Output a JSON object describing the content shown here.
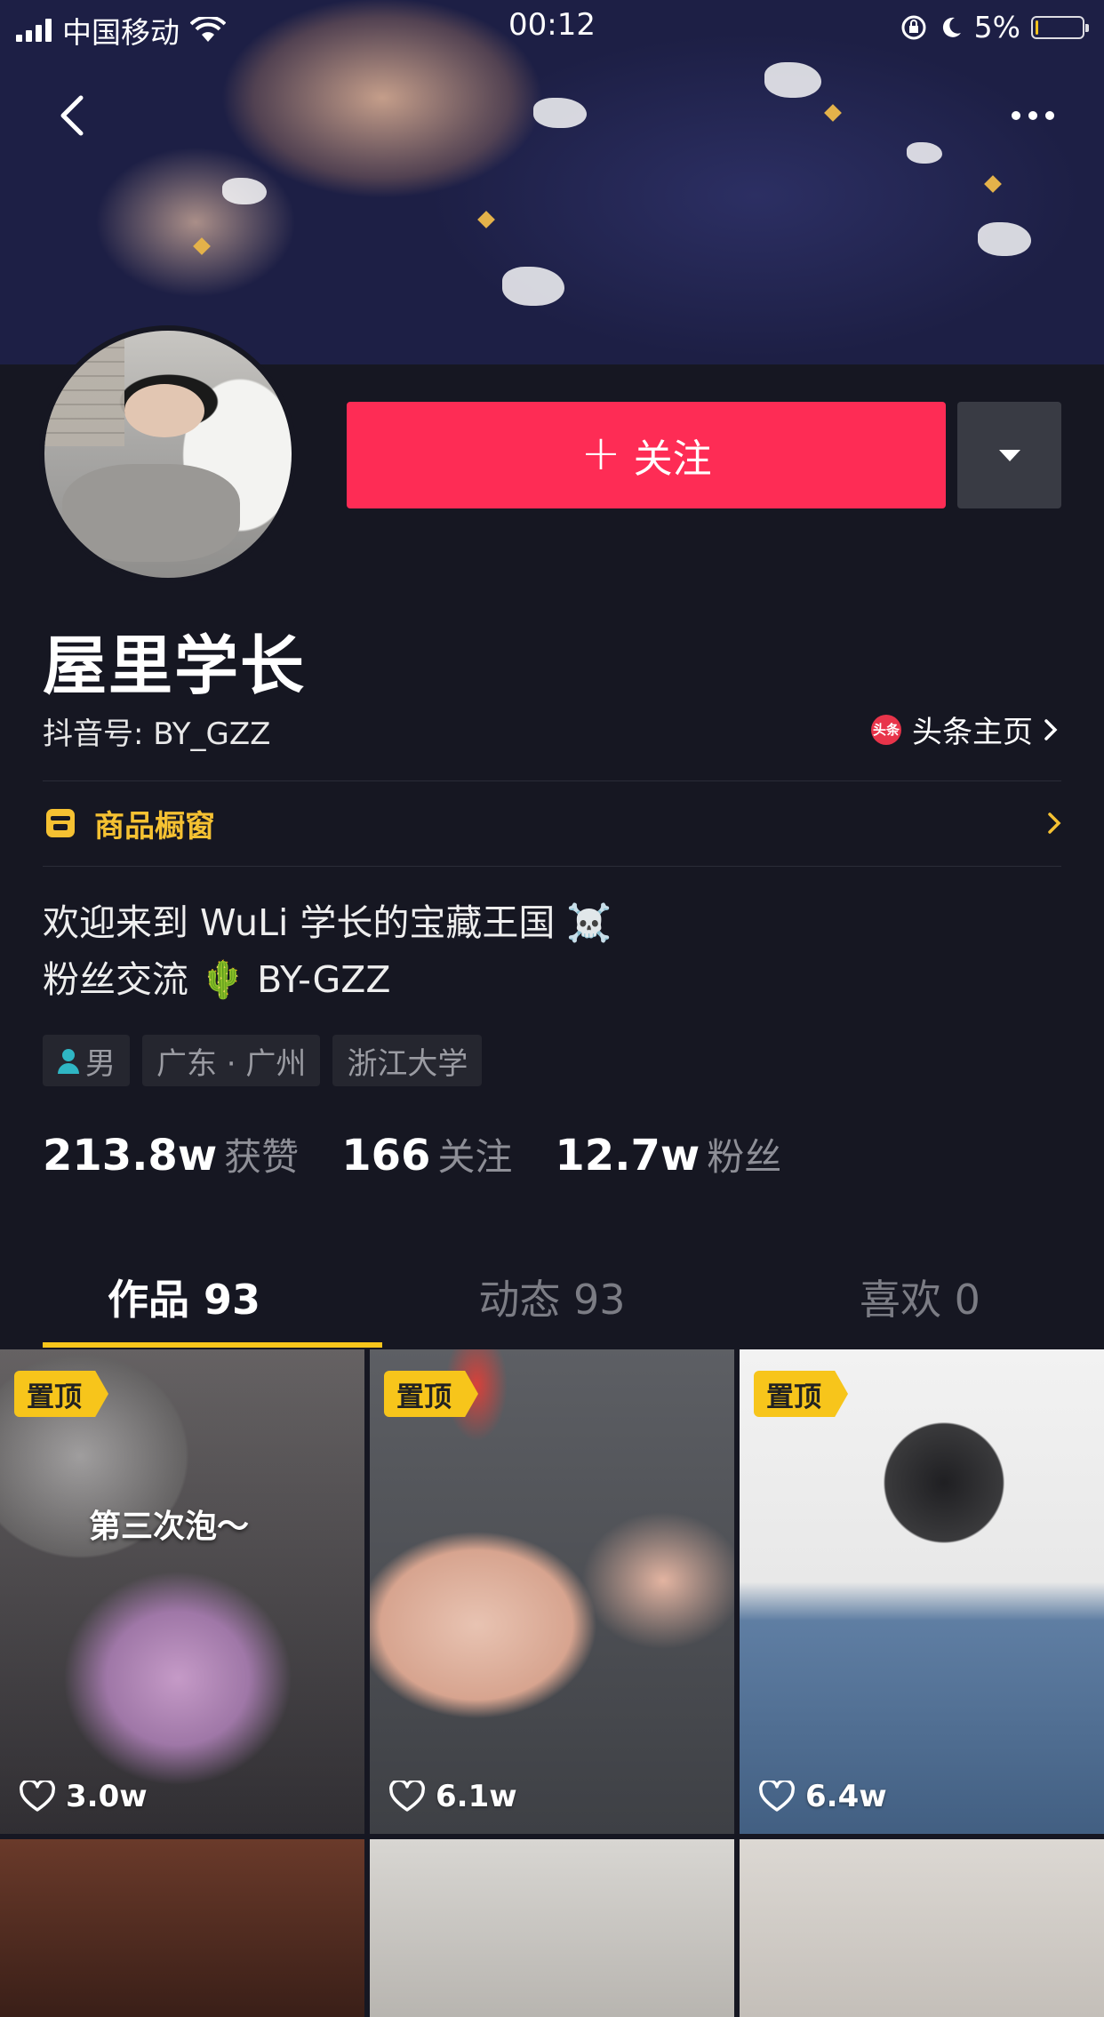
{
  "status_bar": {
    "carrier": "中国移动",
    "time": "00:12",
    "battery": "5%",
    "battery_level": 0.05
  },
  "profile": {
    "follow_label": "关注",
    "nickname": "屋里学长",
    "douyin_id": "抖音号: BY_GZZ",
    "toutiao_label": "头条主页",
    "toutiao_icon_text": "头条",
    "shop_label": "商品橱窗",
    "bio_line1": "欢迎来到 WuLi 学长的宝藏王国 ☠️",
    "bio_line2": "粉丝交流 🌵 BY-GZZ",
    "tags": [
      "男",
      "广东 · 广州",
      "浙江大学"
    ]
  },
  "stats": {
    "likes_count": "213.8w",
    "likes_label": "获赞",
    "following_count": "166",
    "following_label": "关注",
    "fans_count": "12.7w",
    "fans_label": "粉丝"
  },
  "tabs": [
    {
      "label": "作品 93",
      "active": true
    },
    {
      "label": "动态 93",
      "active": false
    },
    {
      "label": "喜欢 0",
      "active": false
    }
  ],
  "videos": [
    {
      "pinned": "置顶",
      "likes": "3.0w",
      "caption": "第三次泡～"
    },
    {
      "pinned": "置顶",
      "likes": "6.1w"
    },
    {
      "pinned": "置顶",
      "likes": "6.4w"
    }
  ],
  "colors": {
    "background": "#161722",
    "follow_button": "#fe2c55",
    "accent_yellow": "#f7c51b",
    "shop_yellow": "#f5c132"
  }
}
